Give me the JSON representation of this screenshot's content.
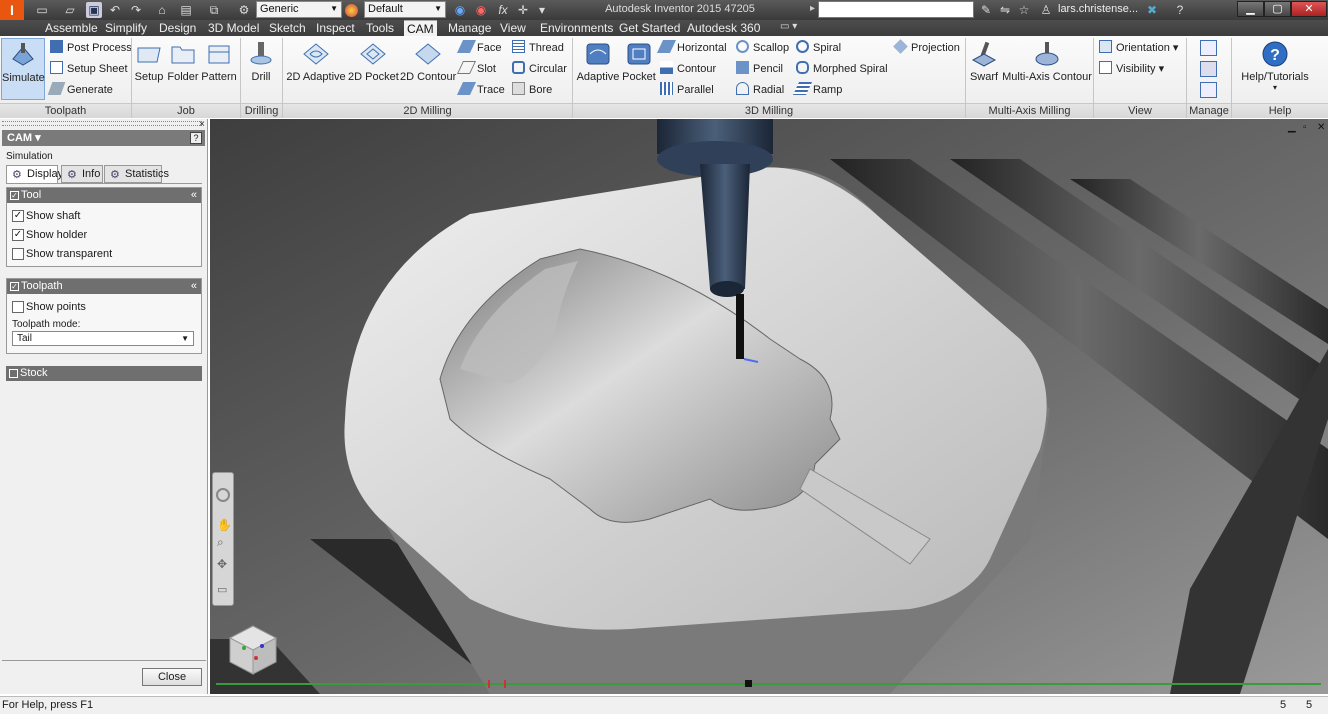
{
  "window": {
    "title": "Autodesk Inventor 2015   47205",
    "user": "lars.christense...",
    "search_placeholder": ""
  },
  "quick_access": {
    "material_select": "Generic",
    "appearance_select": "Default"
  },
  "menu_tabs": [
    "Assemble",
    "Simplify",
    "Design",
    "3D Model",
    "Sketch",
    "Inspect",
    "Tools",
    "CAM",
    "Manage",
    "View",
    "Environments",
    "Get Started",
    "Autodesk 360"
  ],
  "ribbon": {
    "toolpath": {
      "title": "Toolpath",
      "simulate": "Simulate",
      "post_process": "Post Process",
      "setup_sheet": "Setup Sheet",
      "generate": "Generate"
    },
    "job": {
      "title": "Job",
      "setup": "Setup",
      "folder": "Folder",
      "pattern": "Pattern"
    },
    "drilling": {
      "title": "Drilling",
      "drill": "Drill"
    },
    "milling2d": {
      "title": "2D Milling",
      "adaptive": "2D Adaptive",
      "pocket": "2D Pocket",
      "contour": "2D Contour",
      "face": "Face",
      "slot": "Slot",
      "trace": "Trace",
      "thread": "Thread",
      "circular": "Circular",
      "bore": "Bore"
    },
    "milling3d": {
      "title": "3D Milling",
      "adaptive": "Adaptive",
      "pocket": "Pocket",
      "horizontal": "Horizontal",
      "contour": "Contour",
      "parallel": "Parallel",
      "scallop": "Scallop",
      "pencil": "Pencil",
      "radial": "Radial",
      "spiral": "Spiral",
      "morphed_spiral": "Morphed Spiral",
      "ramp": "Ramp",
      "projection": "Projection"
    },
    "multiaxis": {
      "title": "Multi-Axis Milling",
      "swarf": "Swarf",
      "multi_axis_contour": "Multi-Axis Contour"
    },
    "view": {
      "title": "View",
      "orientation": "Orientation",
      "visibility": "Visibility"
    },
    "manage": {
      "title": "Manage"
    },
    "help": {
      "title": "Help",
      "help_tutorials": "Help/Tutorials"
    }
  },
  "panel": {
    "header": "CAM",
    "subtitle": "Simulation",
    "tabs": [
      "Display",
      "Info",
      "Statistics"
    ],
    "tool_group": {
      "title": "Tool",
      "show_shaft": "Show shaft",
      "show_holder": "Show holder",
      "show_transparent": "Show transparent",
      "shaft_checked": true,
      "holder_checked": true,
      "transparent_checked": false
    },
    "toolpath_group": {
      "title": "Toolpath",
      "show_points": "Show points",
      "points_checked": false,
      "mode_label": "Toolpath mode:",
      "mode_value": "Tail"
    },
    "stock_group": {
      "title": "Stock"
    },
    "close": "Close"
  },
  "status": {
    "help_text": "For Help, press F1",
    "count1": "5",
    "count2": "5"
  },
  "colors": {
    "title_bar": "#3f3f3f",
    "accent_orange": "#e8560f",
    "ribbon_icon_blue": "#3f6fb0",
    "timeline_green": "#3c9a3c"
  }
}
